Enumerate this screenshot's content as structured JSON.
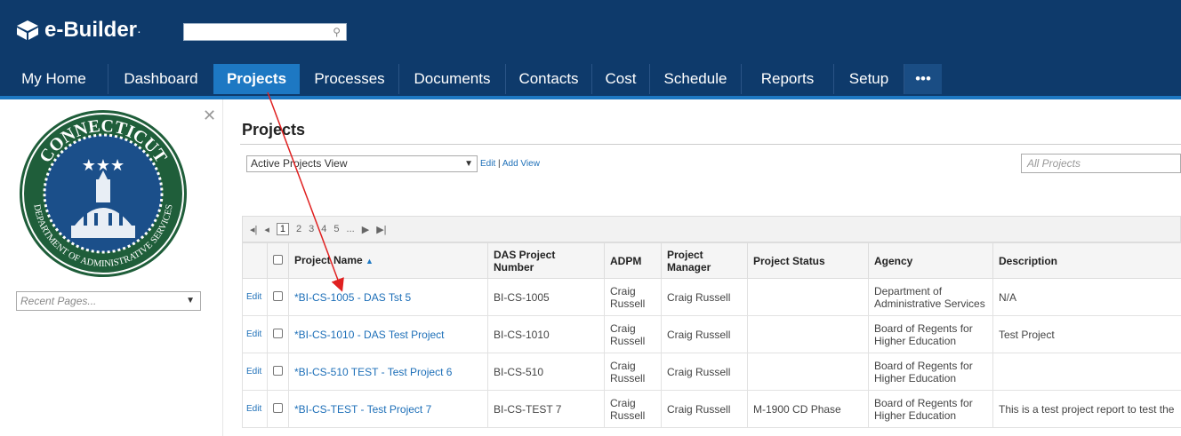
{
  "app": {
    "brand": "e-Builder",
    "reg": "."
  },
  "nav": {
    "tabs": [
      "My Home",
      "Dashboard",
      "Projects",
      "Processes",
      "Documents",
      "Contacts",
      "Cost",
      "Schedule",
      "Reports",
      "Setup",
      "•••"
    ],
    "active": "Projects"
  },
  "sidebar": {
    "recent_placeholder": "Recent Pages...",
    "seal_text": "CONNECTICUT · DEPARTMENT OF ADMINISTRATIVE SERVICES"
  },
  "page": {
    "title": "Projects",
    "view_select": "Active Projects View",
    "edit_link": "Edit",
    "add_view_link": "Add View",
    "scope_placeholder": "All Projects"
  },
  "pager": {
    "first": "◂|",
    "prev": "◂",
    "pages": [
      "1",
      "2",
      "3",
      "4",
      "5",
      "..."
    ],
    "next": "▶",
    "last": "▶|"
  },
  "grid": {
    "columns": [
      "Project Name",
      "DAS Project Number",
      "ADPM",
      "Project Manager",
      "Project Status",
      "Agency",
      "Description"
    ],
    "edit_label": "Edit",
    "rows": [
      {
        "name": "*BI-CS-1005 - DAS Tst 5",
        "number": "BI-CS-1005",
        "adpm": "Craig Russell",
        "pm": "Craig Russell",
        "status": "",
        "agency": "Department of Administrative Services",
        "description": "N/A"
      },
      {
        "name": "*BI-CS-1010 - DAS Test Project",
        "number": "BI-CS-1010",
        "adpm": "Craig Russell",
        "pm": "Craig Russell",
        "status": "",
        "agency": "Board of Regents for Higher Education",
        "description": "Test Project"
      },
      {
        "name": "*BI-CS-510 TEST - Test Project 6",
        "number": "BI-CS-510",
        "adpm": "Craig Russell",
        "pm": "Craig Russell",
        "status": "",
        "agency": "Board of Regents for Higher Education",
        "description": ""
      },
      {
        "name": "*BI-CS-TEST - Test Project 7",
        "number": "BI-CS-TEST 7",
        "adpm": "Craig Russell",
        "pm": "Craig Russell",
        "status": "M-1900 CD Phase",
        "agency": "Board of Regents for Higher Education",
        "description": "This is a test project report to test the"
      }
    ]
  },
  "colors": {
    "header": "#0e3a6b",
    "active_tab": "#1d78c3",
    "link": "#1d6fb8",
    "annotation_arrow": "#e02020"
  }
}
